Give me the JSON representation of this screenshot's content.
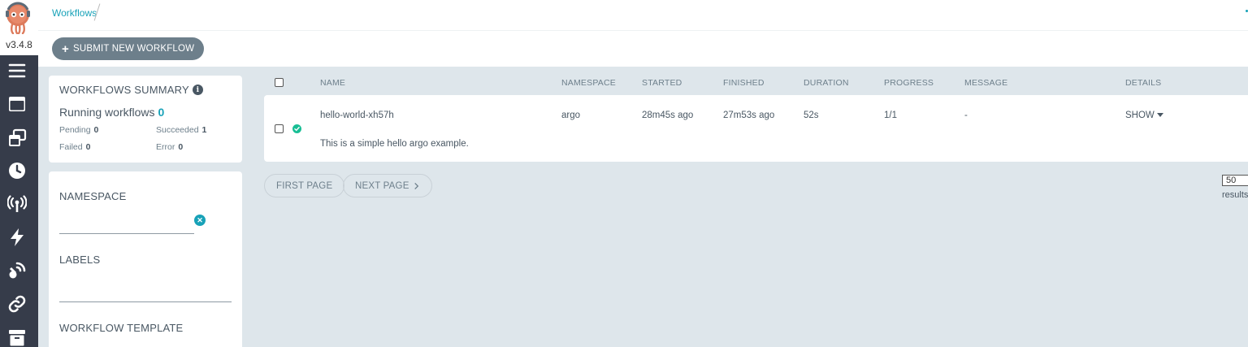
{
  "app": {
    "version": "v3.4.8",
    "breadcrumb": "Workflows"
  },
  "sidebar": {
    "items": [
      {
        "icon": "menu-icon"
      },
      {
        "icon": "workflows-icon"
      },
      {
        "icon": "workflow-templates-icon"
      },
      {
        "icon": "cron-workflows-icon"
      },
      {
        "icon": "event-sources-icon"
      },
      {
        "icon": "sensors-icon"
      },
      {
        "icon": "event-flow-icon"
      },
      {
        "icon": "links-icon"
      },
      {
        "icon": "archive-icon"
      }
    ]
  },
  "toolbar": {
    "submit_label": "SUBMIT NEW WORKFLOW"
  },
  "summary": {
    "title": "WORKFLOWS SUMMARY",
    "running_label": "Running workflows",
    "running_count": "0",
    "pending_label": "Pending",
    "pending_count": "0",
    "succeeded_label": "Succeeded",
    "succeeded_count": "1",
    "failed_label": "Failed",
    "failed_count": "0",
    "error_label": "Error",
    "error_count": "0"
  },
  "filters": {
    "namespace_label": "NAMESPACE",
    "namespace_value": "",
    "labels_label": "LABELS",
    "template_label": "WORKFLOW TEMPLATE"
  },
  "table": {
    "headers": {
      "name": "NAME",
      "namespace": "NAMESPACE",
      "started": "STARTED",
      "finished": "FINISHED",
      "duration": "DURATION",
      "progress": "PROGRESS",
      "message": "MESSAGE",
      "details": "DETAILS"
    },
    "rows": [
      {
        "name": "hello-world-xh57h",
        "namespace": "argo",
        "started": "28m45s ago",
        "finished": "27m53s ago",
        "duration": "52s",
        "progress": "1/1",
        "message": "-",
        "details": "SHOW",
        "description": "This is a simple hello argo example.",
        "status": "succeeded",
        "status_color": "#18be94"
      }
    ]
  },
  "pagination": {
    "first_label": "FIRST PAGE",
    "next_label": "NEXT PAGE",
    "page_size": "50",
    "results_label": "results"
  },
  "colors": {
    "accent": "#18a2b8",
    "sidebar": "#363c4a",
    "background": "#dee6eb"
  }
}
